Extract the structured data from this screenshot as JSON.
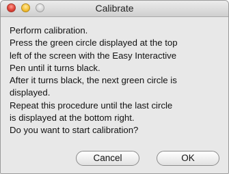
{
  "window": {
    "title": "Calibrate"
  },
  "message": {
    "lines": [
      "Perform calibration.",
      "Press the green circle displayed at the top",
      "left of the screen with the Easy Interactive",
      "Pen until it turns black.",
      "After it turns black, the next green circle is",
      "displayed.",
      "Repeat this procedure until the last circle",
      "is displayed at the bottom right.",
      "Do you want to start calibration?"
    ]
  },
  "buttons": {
    "cancel_label": "Cancel",
    "ok_label": "OK"
  },
  "colors": {
    "close": "#e0443a",
    "minimize": "#f5c33a",
    "maximize": "#d6d6d6"
  }
}
